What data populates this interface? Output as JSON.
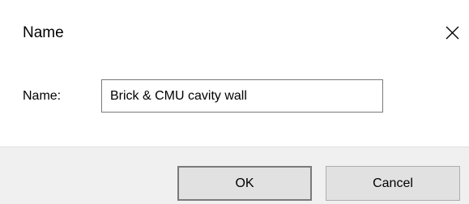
{
  "window": {
    "title": "Name",
    "close_icon": "close-icon"
  },
  "form": {
    "name_label": "Name:",
    "name_value": "Brick & CMU cavity wall",
    "name_placeholder": ""
  },
  "buttons": {
    "ok_label": "OK",
    "cancel_label": "Cancel"
  },
  "colors": {
    "footer_background": "#f0f0f0",
    "button_background": "#e1e1e1",
    "default_button_border": "#7a7a7a"
  }
}
